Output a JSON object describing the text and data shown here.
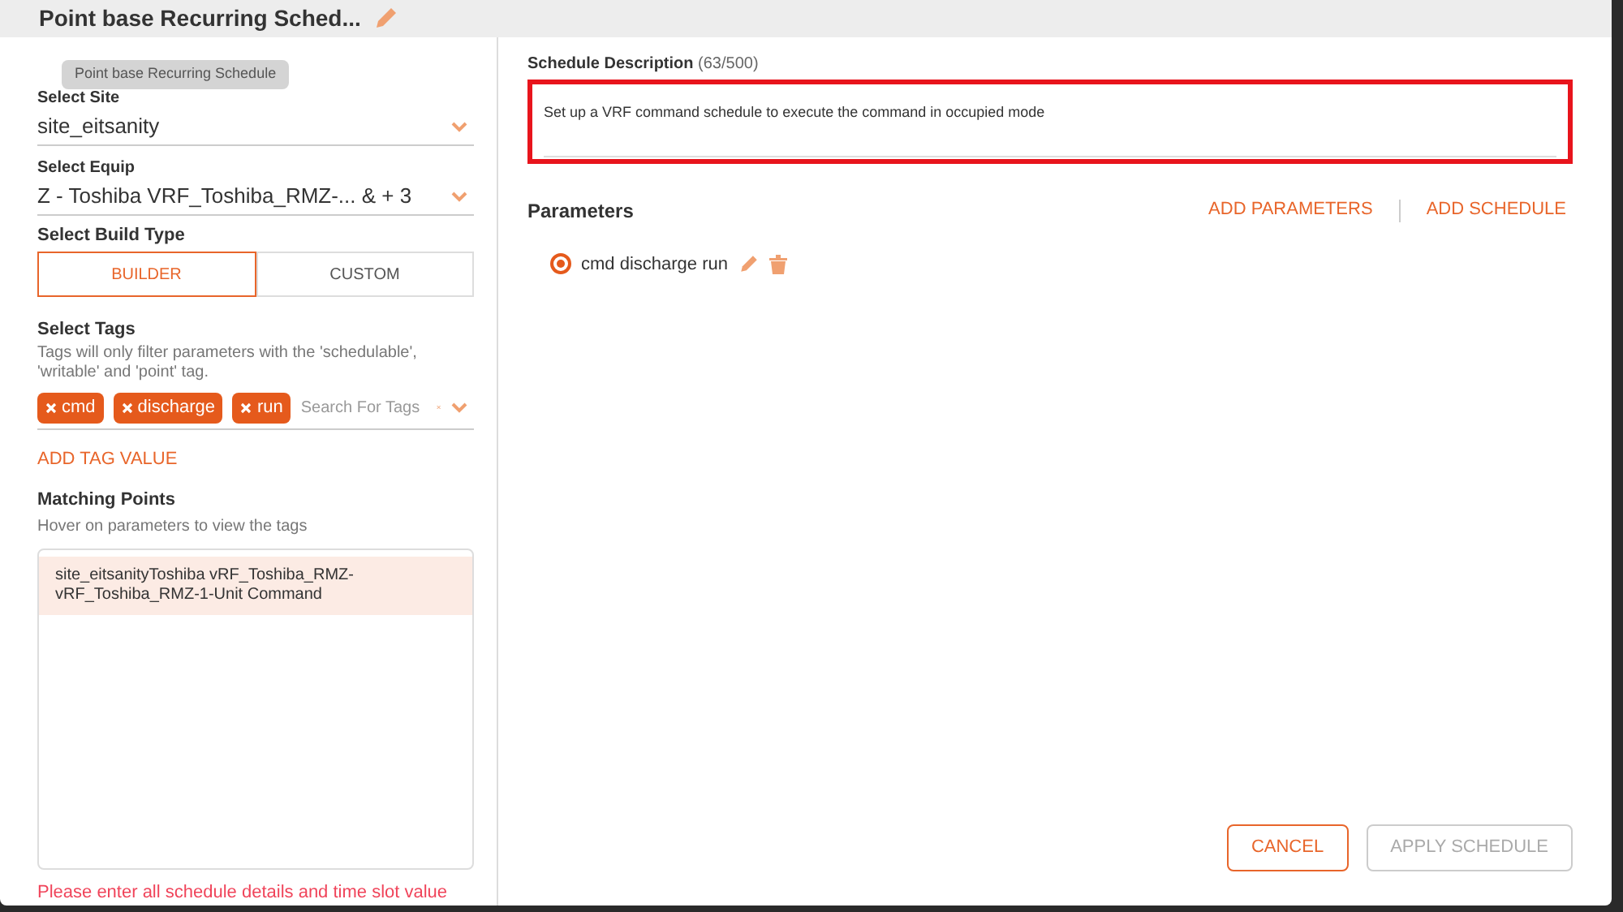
{
  "dialog": {
    "title": "Point base Recurring Sched...",
    "tooltip": "Point base Recurring Schedule"
  },
  "site": {
    "label": "Select Site",
    "value": "site_eitsanity"
  },
  "equip": {
    "label": "Select Equip",
    "value": "Z - Toshiba VRF_Toshiba_RMZ-... & + 3"
  },
  "build_type": {
    "label": "Select Build Type",
    "options": [
      {
        "label": "BUILDER",
        "selected": true
      },
      {
        "label": "CUSTOM",
        "selected": false
      }
    ]
  },
  "tags": {
    "label": "Select Tags",
    "hint": "Tags will only filter parameters with the 'schedulable', 'writable' and 'point' tag.",
    "chips": [
      {
        "label": "cmd"
      },
      {
        "label": "discharge"
      },
      {
        "label": "run"
      }
    ],
    "placeholder": "Search For Tags",
    "add_link": "ADD TAG VALUE"
  },
  "matching": {
    "label": "Matching Points",
    "hint": "Hover on parameters to view the tags",
    "items": [
      "site_eitsanityToshiba vRF_Toshiba_RMZ-vRF_Toshiba_RMZ-1-Unit Command"
    ]
  },
  "error": "Please enter all schedule details and time slot value",
  "description": {
    "label": "Schedule Description",
    "count": "(63/500)",
    "value": "Set up a VRF command schedule to execute the command in occupied mode",
    "highlighted": true
  },
  "parameters": {
    "title": "Parameters",
    "actions": [
      "ADD PARAMETERS",
      "ADD SCHEDULE"
    ],
    "items": [
      {
        "label": "cmd discharge run",
        "selected": true
      }
    ]
  },
  "buttons": [
    {
      "label": "CANCEL",
      "disabled": false
    },
    {
      "label": "APPLY SCHEDULE",
      "disabled": true
    }
  ]
}
